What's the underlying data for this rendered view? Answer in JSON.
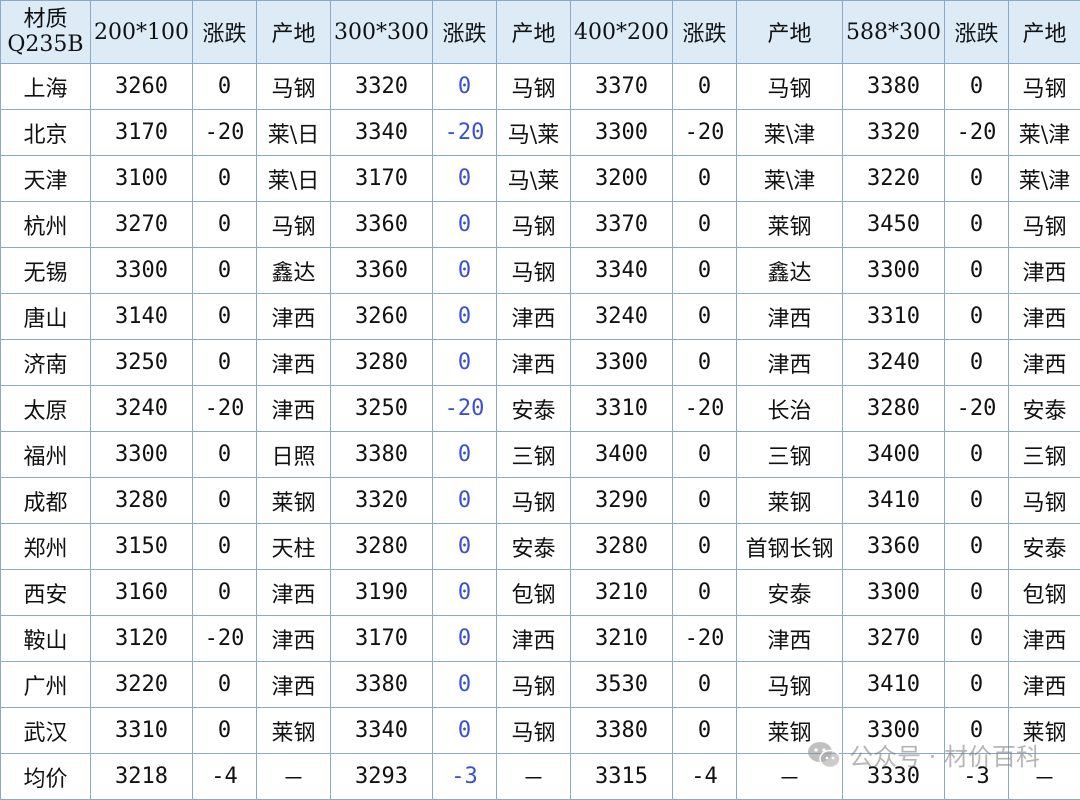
{
  "header": {
    "corner_line1": "材质",
    "corner_line2": "Q235B",
    "groups": [
      {
        "spec": "200*100",
        "change": "涨跌",
        "origin": "产地"
      },
      {
        "spec": "300*300",
        "change": "涨跌",
        "origin": "产地"
      },
      {
        "spec": "400*200",
        "change": "涨跌",
        "origin": "产地"
      },
      {
        "spec": "588*300",
        "change": "涨跌",
        "origin": "产地"
      }
    ]
  },
  "rows": [
    {
      "city": "上海",
      "cells": [
        [
          "3260",
          "0",
          "马钢"
        ],
        [
          "3320",
          "0",
          "马钢"
        ],
        [
          "3370",
          "0",
          "马钢"
        ],
        [
          "3380",
          "0",
          "马钢"
        ]
      ]
    },
    {
      "city": "北京",
      "cells": [
        [
          "3170",
          "-20",
          "莱\\日"
        ],
        [
          "3340",
          "-20",
          "马\\莱"
        ],
        [
          "3300",
          "-20",
          "莱\\津"
        ],
        [
          "3320",
          "-20",
          "莱\\津"
        ]
      ]
    },
    {
      "city": "天津",
      "cells": [
        [
          "3100",
          "0",
          "莱\\日"
        ],
        [
          "3170",
          "0",
          "马\\莱"
        ],
        [
          "3200",
          "0",
          "莱\\津"
        ],
        [
          "3220",
          "0",
          "莱\\津"
        ]
      ]
    },
    {
      "city": "杭州",
      "cells": [
        [
          "3270",
          "0",
          "马钢"
        ],
        [
          "3360",
          "0",
          "马钢"
        ],
        [
          "3370",
          "0",
          "莱钢"
        ],
        [
          "3450",
          "0",
          "马钢"
        ]
      ]
    },
    {
      "city": "无锡",
      "cells": [
        [
          "3300",
          "0",
          "鑫达"
        ],
        [
          "3360",
          "0",
          "马钢"
        ],
        [
          "3340",
          "0",
          "鑫达"
        ],
        [
          "3300",
          "0",
          "津西"
        ]
      ]
    },
    {
      "city": "唐山",
      "cells": [
        [
          "3140",
          "0",
          "津西"
        ],
        [
          "3260",
          "0",
          "津西"
        ],
        [
          "3240",
          "0",
          "津西"
        ],
        [
          "3310",
          "0",
          "津西"
        ]
      ]
    },
    {
      "city": "济南",
      "cells": [
        [
          "3250",
          "0",
          "津西"
        ],
        [
          "3280",
          "0",
          "津西"
        ],
        [
          "3300",
          "0",
          "津西"
        ],
        [
          "3240",
          "0",
          "津西"
        ]
      ]
    },
    {
      "city": "太原",
      "cells": [
        [
          "3240",
          "-20",
          "津西"
        ],
        [
          "3250",
          "-20",
          "安泰"
        ],
        [
          "3310",
          "-20",
          "长治"
        ],
        [
          "3280",
          "-20",
          "安泰"
        ]
      ]
    },
    {
      "city": "福州",
      "cells": [
        [
          "3300",
          "0",
          "日照"
        ],
        [
          "3380",
          "0",
          "三钢"
        ],
        [
          "3400",
          "0",
          "三钢"
        ],
        [
          "3400",
          "0",
          "三钢"
        ]
      ]
    },
    {
      "city": "成都",
      "cells": [
        [
          "3280",
          "0",
          "莱钢"
        ],
        [
          "3320",
          "0",
          "马钢"
        ],
        [
          "3290",
          "0",
          "莱钢"
        ],
        [
          "3410",
          "0",
          "马钢"
        ]
      ]
    },
    {
      "city": "郑州",
      "cells": [
        [
          "3150",
          "0",
          "天柱"
        ],
        [
          "3280",
          "0",
          "安泰"
        ],
        [
          "3280",
          "0",
          "首钢长钢"
        ],
        [
          "3360",
          "0",
          "安泰"
        ]
      ]
    },
    {
      "city": "西安",
      "cells": [
        [
          "3160",
          "0",
          "津西"
        ],
        [
          "3190",
          "0",
          "包钢"
        ],
        [
          "3210",
          "0",
          "安泰"
        ],
        [
          "3300",
          "0",
          "包钢"
        ]
      ]
    },
    {
      "city": "鞍山",
      "cells": [
        [
          "3120",
          "-20",
          "津西"
        ],
        [
          "3170",
          "0",
          "津西"
        ],
        [
          "3210",
          "-20",
          "津西"
        ],
        [
          "3270",
          "0",
          "津西"
        ]
      ]
    },
    {
      "city": "广州",
      "cells": [
        [
          "3220",
          "0",
          "津西"
        ],
        [
          "3380",
          "0",
          "马钢"
        ],
        [
          "3530",
          "0",
          "马钢"
        ],
        [
          "3410",
          "0",
          "津西"
        ]
      ]
    },
    {
      "city": "武汉",
      "cells": [
        [
          "3310",
          "0",
          "莱钢"
        ],
        [
          "3340",
          "0",
          "马钢"
        ],
        [
          "3380",
          "0",
          "莱钢"
        ],
        [
          "3300",
          "0",
          "莱钢"
        ]
      ]
    },
    {
      "city": "均价",
      "cells": [
        [
          "3218",
          "-4",
          "－"
        ],
        [
          "3293",
          "-3",
          "－"
        ],
        [
          "3315",
          "-4",
          "－"
        ],
        [
          "3330",
          "-3",
          "－"
        ]
      ]
    }
  ],
  "watermark": {
    "icon": "wechat-icon",
    "text": "公众号 · 材价百科"
  },
  "colors": {
    "header_bg": "#ddebf7",
    "border": "#8ea9c8",
    "price_text": "#3b4fd6",
    "body_text": "#111111"
  }
}
